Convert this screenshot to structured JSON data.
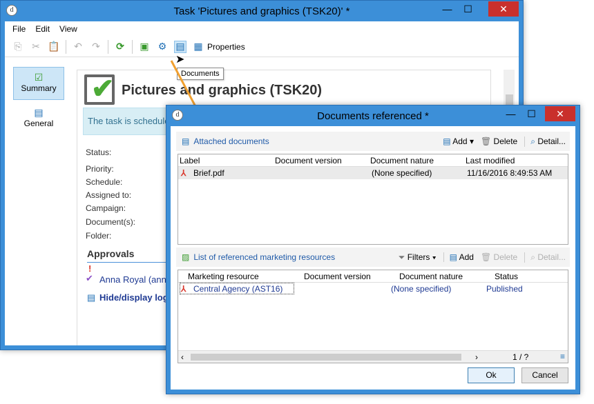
{
  "main_window": {
    "title": "Task 'Pictures and graphics (TSK20)' *",
    "menu": [
      "File",
      "Edit",
      "View"
    ],
    "toolbar": {
      "properties_label": "Properties"
    },
    "tooltip": "Documents",
    "sidebar": [
      {
        "label": "Summary",
        "icon": "check-icon",
        "selected": true
      },
      {
        "label": "General",
        "icon": "clipboard-icon",
        "selected": false
      }
    ],
    "heading": "Pictures and graphics (TSK20)",
    "info_banner": "The task is schedule",
    "fields": {
      "status": "Status:",
      "priority": "Priority:",
      "schedule": "Schedule:",
      "assigned_to": "Assigned to:",
      "campaign": "Campaign:",
      "documents": "Document(s):",
      "folder": "Folder:"
    },
    "approvals": {
      "title": "Approvals",
      "approver": "Anna Royal (anna",
      "logs_link": "Hide/display logs"
    }
  },
  "dialog": {
    "title": "Documents referenced *",
    "attached": {
      "title": "Attached documents",
      "add_label": "Add",
      "delete_label": "Delete",
      "detail_label": "Detail...",
      "columns": [
        "Label",
        "Document version",
        "Document nature",
        "Last modified"
      ],
      "rows": [
        {
          "label": "Brief.pdf",
          "version": "",
          "nature": "(None specified)",
          "modified": "11/16/2016 8:49:53 AM"
        }
      ]
    },
    "marketing": {
      "title": "List of referenced marketing resources",
      "filters_label": "Filters",
      "add_label": "Add",
      "delete_label": "Delete",
      "detail_label": "Detail...",
      "columns": [
        "Marketing resource",
        "Document version",
        "Document nature",
        "Status"
      ],
      "rows": [
        {
          "resource": "Central Agency (AST16)",
          "version": "",
          "nature": "(None specified)",
          "status": "Published"
        }
      ],
      "pager": "1 / ?"
    },
    "ok_label": "Ok",
    "cancel_label": "Cancel"
  },
  "colors": {
    "accent": "#3c8fd8",
    "close": "#c9302c",
    "link": "#1f5aa8",
    "arrow": "#f0a030"
  }
}
